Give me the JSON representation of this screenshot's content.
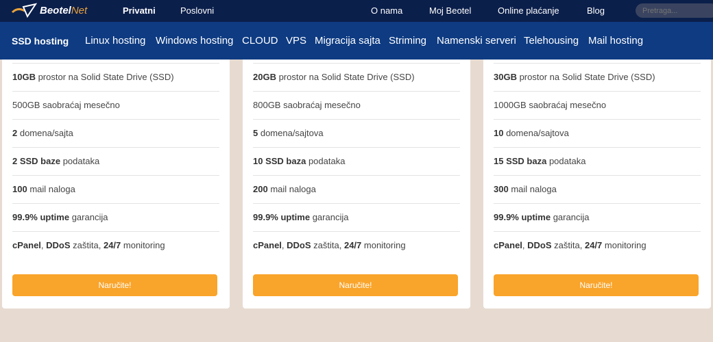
{
  "header": {
    "logo": {
      "part1": "Beotel",
      "part2": "Net"
    },
    "primary": [
      "Privatni",
      "Poslovni"
    ],
    "right": [
      "O nama",
      "Moj Beotel",
      "Online plaćanje",
      "Blog"
    ],
    "search_placeholder": "Pretraga..."
  },
  "nav": [
    "SSD hosting",
    "Linux hosting",
    "Windows hosting",
    "CLOUD",
    "VPS",
    "Migracija sajta",
    "Striming",
    "Namenski serveri",
    "Telehousing",
    "Mail hosting"
  ],
  "colors": {
    "top_bar": "#0b1f4b",
    "nav_bar": "#0e3b82",
    "button": "#f9a42a",
    "background": "#e7dbd1"
  },
  "plans": [
    {
      "rows": [
        [
          [
            "10GB",
            1
          ],
          [
            " prostor na Solid State Drive (SSD)",
            0
          ]
        ],
        [
          [
            "500GB",
            0
          ],
          [
            " saobraćaj mesečno",
            0
          ]
        ],
        [
          [
            "2",
            1
          ],
          [
            " domena/sajta",
            0
          ]
        ],
        [
          [
            "2 SSD baze",
            1
          ],
          [
            " podataka",
            0
          ]
        ],
        [
          [
            "100",
            1
          ],
          [
            " mail naloga",
            0
          ]
        ],
        [
          [
            "99.9% uptime",
            1
          ],
          [
            " garancija",
            0
          ]
        ],
        [
          [
            "cPanel",
            1
          ],
          [
            ", ",
            0
          ],
          [
            "DDoS",
            1
          ],
          [
            " zaštita, ",
            0
          ],
          [
            "24/7",
            1
          ],
          [
            " monitoring",
            0
          ]
        ]
      ],
      "button": "Naručite!"
    },
    {
      "rows": [
        [
          [
            "20GB",
            1
          ],
          [
            " prostor na Solid State Drive (SSD)",
            0
          ]
        ],
        [
          [
            "800GB",
            0
          ],
          [
            " saobraćaj mesečno",
            0
          ]
        ],
        [
          [
            "5",
            1
          ],
          [
            " domena/sajtova",
            0
          ]
        ],
        [
          [
            "10 SSD baza",
            1
          ],
          [
            " podataka",
            0
          ]
        ],
        [
          [
            "200",
            1
          ],
          [
            " mail naloga",
            0
          ]
        ],
        [
          [
            "99.9% uptime",
            1
          ],
          [
            " garancija",
            0
          ]
        ],
        [
          [
            "cPanel",
            1
          ],
          [
            ", ",
            0
          ],
          [
            "DDoS",
            1
          ],
          [
            " zaštita, ",
            0
          ],
          [
            "24/7",
            1
          ],
          [
            " monitoring",
            0
          ]
        ]
      ],
      "button": "Naručite!"
    },
    {
      "rows": [
        [
          [
            "30GB",
            1
          ],
          [
            " prostor na Solid State Drive (SSD)",
            0
          ]
        ],
        [
          [
            "1000GB",
            0
          ],
          [
            " saobraćaj mesečno",
            0
          ]
        ],
        [
          [
            "10",
            1
          ],
          [
            " domena/sajtova",
            0
          ]
        ],
        [
          [
            "15 SSD baza",
            1
          ],
          [
            " podataka",
            0
          ]
        ],
        [
          [
            "300",
            1
          ],
          [
            " mail naloga",
            0
          ]
        ],
        [
          [
            "99.9% uptime",
            1
          ],
          [
            " garancija",
            0
          ]
        ],
        [
          [
            "cPanel",
            1
          ],
          [
            ", ",
            0
          ],
          [
            "DDoS",
            1
          ],
          [
            " zaštita, ",
            0
          ],
          [
            "24/7",
            1
          ],
          [
            " monitoring",
            0
          ]
        ]
      ],
      "button": "Naručite!"
    }
  ]
}
